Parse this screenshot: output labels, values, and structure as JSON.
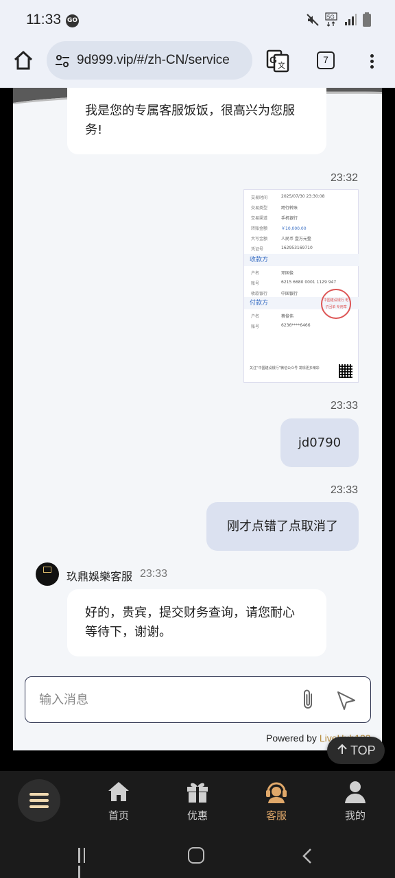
{
  "status_bar": {
    "time": "11:33",
    "go_badge": "GO",
    "icons": [
      "mute-icon",
      "5g-icon",
      "signal-icon",
      "battery-icon"
    ]
  },
  "browser": {
    "url": "9d999.vip/#/zh-CN/service",
    "tab_count": "7"
  },
  "chat": {
    "messages": [
      {
        "from": "agent",
        "text_line1": "我是您的专属客服饭饭，很高兴为您服",
        "text_line2": "务!"
      },
      {
        "from": "user",
        "time": "23:32",
        "type": "image"
      },
      {
        "from": "user",
        "time": "23:33",
        "text": "jd0790"
      },
      {
        "from": "user",
        "time": "23:33",
        "text": "刚才点错了点取消了"
      },
      {
        "from": "agent",
        "name": "玖鼎娛樂客服",
        "time": "23:33",
        "text_line1": "好的，贵宾，提交财务查询，请您耐心",
        "text_line2": "等待下，谢谢。"
      }
    ],
    "receipt": {
      "rows": [
        {
          "k": "交易时间",
          "v": "2025/07/30 23:30:08"
        },
        {
          "k": "交易类型",
          "v": "跨行转账"
        },
        {
          "k": "交易渠道",
          "v": "手机银行"
        },
        {
          "k": "转账金额",
          "v": "￥10,000.00"
        },
        {
          "k": "大写金额",
          "v": "人民币 壹万元整"
        },
        {
          "k": "凭证号",
          "v": "162953169710"
        }
      ],
      "payee_title": "收款方",
      "payee_rows": [
        {
          "k": "户名",
          "v": "邓国俊"
        },
        {
          "k": "账号",
          "v": "6215 6680 0001 1129 947"
        },
        {
          "k": "收款银行",
          "v": "中国银行"
        }
      ],
      "payer_title": "付款方",
      "payer_rows": [
        {
          "k": "户名",
          "v": "蔡俊伟"
        },
        {
          "k": "账号",
          "v": "6236****6466"
        }
      ],
      "stamp": "中国建设银行 电子回单 专用章",
      "footer": "关注“中国建设银行”微信公众号 发现更多精彩"
    },
    "input_placeholder": "输入消息",
    "powered_prefix": "Powered by ",
    "powered_brand": "LiveHub123"
  },
  "top_button": "TOP",
  "bottom_nav": [
    {
      "label": "首页",
      "icon": "home-icon"
    },
    {
      "label": "优惠",
      "icon": "gift-icon"
    },
    {
      "label": "客服",
      "icon": "support-agent-icon",
      "active": true
    },
    {
      "label": "我的",
      "icon": "user-icon"
    }
  ],
  "colors": {
    "accent": "#e0a86a",
    "user_bubble": "#dbe1f0",
    "chat_bg": "#f4f6f9"
  }
}
